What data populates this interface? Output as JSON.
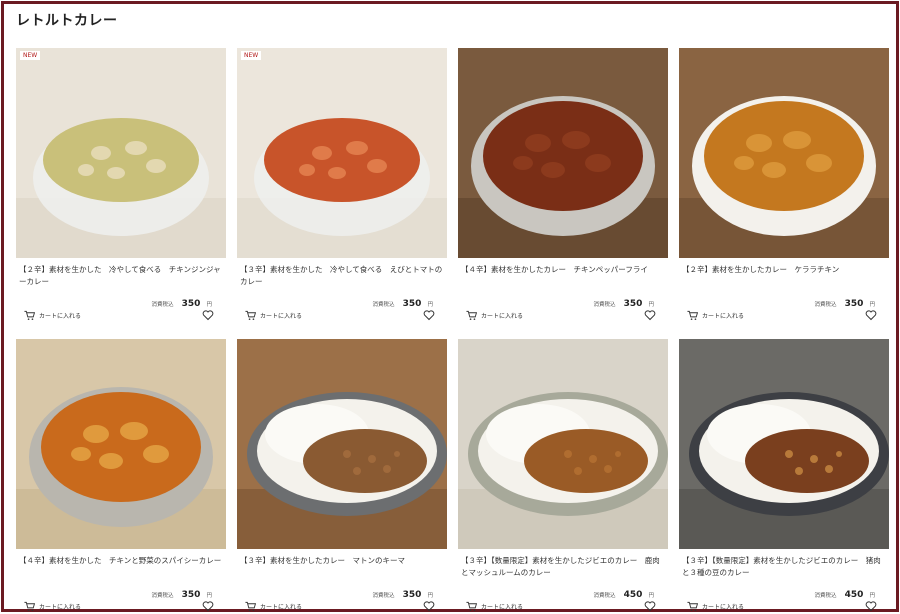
{
  "page": {
    "title": "レトルトカレー"
  },
  "colors": {
    "frame": "#6b1a22",
    "badge_text": "#b31b1b"
  },
  "products": [
    {
      "badge": "NEW",
      "name": "【２辛】素材を生かした　冷やして食べる　チキンジンジャーカレー",
      "tax_label": "消費税込",
      "price": "350",
      "currency": "円",
      "cart_label": "カートに入れる",
      "cart_icon": "cart-icon",
      "fav_icon": "heart-icon",
      "dish": "green",
      "row": 1
    },
    {
      "badge": "NEW",
      "name": "【３辛】素材を生かした　冷やして食べる　えびとトマトのカレー",
      "tax_label": "消費税込",
      "price": "350",
      "currency": "円",
      "cart_label": "カートに入れる",
      "cart_icon": "cart-icon",
      "fav_icon": "heart-icon",
      "dish": "shrimp",
      "row": 1
    },
    {
      "badge": "",
      "name": "【４辛】素材を生かしたカレー　チキンペッパーフライ",
      "tax_label": "消費税込",
      "price": "350",
      "currency": "円",
      "cart_label": "カートに入れる",
      "cart_icon": "cart-icon",
      "fav_icon": "heart-icon",
      "dish": "pepper",
      "row": 1
    },
    {
      "badge": "",
      "name": "【２辛】素材を生かしたカレー　ケララチキン",
      "tax_label": "消費税込",
      "price": "350",
      "currency": "円",
      "cart_label": "カートに入れる",
      "cart_icon": "cart-icon",
      "fav_icon": "heart-icon",
      "dish": "kerala",
      "row": 1
    },
    {
      "badge": "",
      "name": "【４辛】素材を生かした　チキンと野菜のスパイシーカレー",
      "tax_label": "消費税込",
      "price": "350",
      "currency": "円",
      "cart_label": "カートに入れる",
      "cart_icon": "cart-icon",
      "fav_icon": "heart-icon",
      "dish": "veg",
      "row": 2
    },
    {
      "badge": "",
      "name": "【３辛】素材を生かしたカレー　マトンのキーマ",
      "tax_label": "消費税込",
      "price": "350",
      "currency": "円",
      "cart_label": "カートに入れる",
      "cart_icon": "cart-icon",
      "fav_icon": "heart-icon",
      "dish": "keema",
      "row": 2
    },
    {
      "badge": "",
      "name": "【３辛】【数量限定】素材を生かしたジビエのカレー　鹿肉とマッシュルームのカレー",
      "tax_label": "消費税込",
      "price": "450",
      "currency": "円",
      "cart_label": "カートに入れる",
      "cart_icon": "cart-icon",
      "fav_icon": "heart-icon",
      "dish": "venison",
      "row": 2
    },
    {
      "badge": "",
      "name": "【３辛】【数量限定】素材を生かしたジビエのカレー　猪肉と３種の豆のカレー",
      "tax_label": "消費税込",
      "price": "450",
      "currency": "円",
      "cart_label": "カートに入れる",
      "cart_icon": "cart-icon",
      "fav_icon": "heart-icon",
      "dish": "boar",
      "row": 2
    }
  ]
}
